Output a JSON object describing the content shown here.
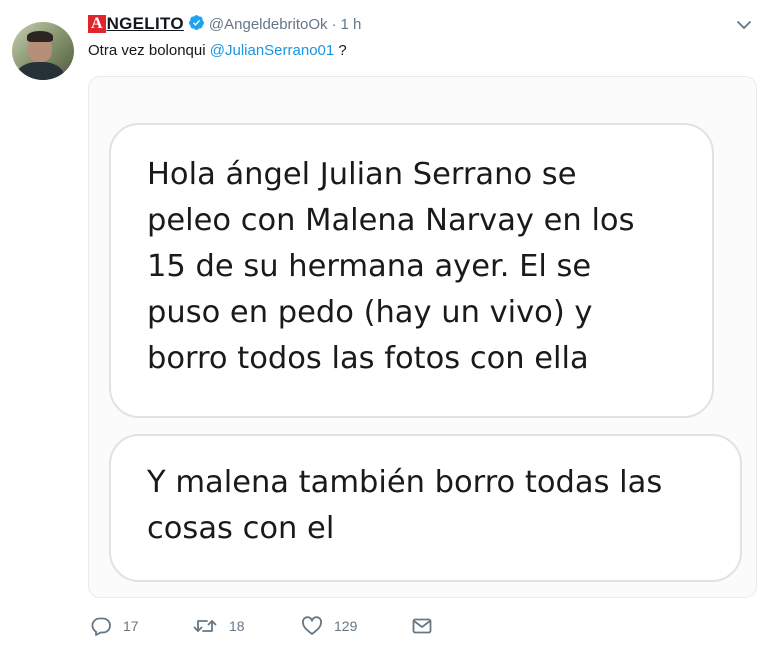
{
  "tweet": {
    "brand_first_letter": "A",
    "brand_rest": "NGELITO",
    "handle": "@AngeldebritoOk",
    "separator": "·",
    "time": "1 h",
    "text_before": "Otra vez bolonqui ",
    "mention": "@JulianSerrano01",
    "text_after": " ?"
  },
  "media": {
    "bubbles": [
      {
        "lines": [
          "Hola ángel Julian Serrano se",
          "peleo con Malena Narvay en los",
          "15 de su hermana ayer. El se",
          "puso en pedo (hay un vivo) y",
          "borro todos las fotos con ella"
        ]
      },
      {
        "lines": [
          "Y malena también borro todas las",
          "cosas con el"
        ]
      }
    ]
  },
  "actions": {
    "reply_count": "17",
    "retweet_count": "18",
    "like_count": "129"
  },
  "icons": {
    "verified": "verified-badge-icon",
    "caret": "chevron-down-icon",
    "reply": "reply-icon",
    "retweet": "retweet-icon",
    "like": "heart-icon",
    "dm": "envelope-icon"
  },
  "colors": {
    "brand_red": "#e0242c",
    "mention_blue": "#1b95e0",
    "verified_blue": "#1da1f2",
    "muted_gray": "#657786"
  }
}
